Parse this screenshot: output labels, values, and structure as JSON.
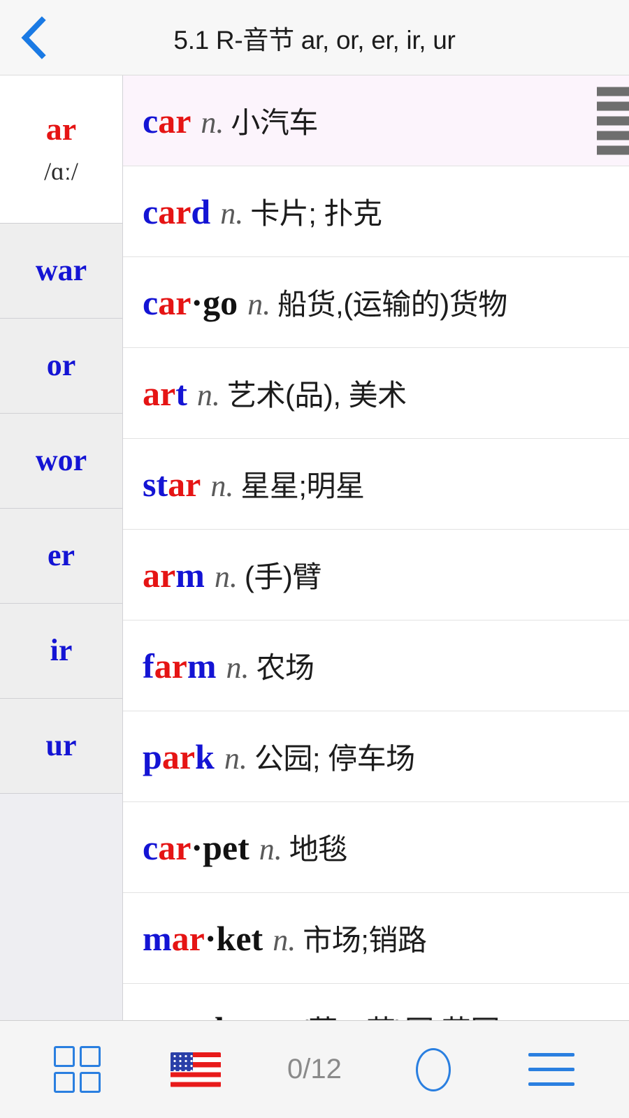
{
  "header": {
    "back_icon": "chevron-left-icon",
    "title": "5.1 R-音节 ar, or, er, ir, ur"
  },
  "sidebar": {
    "items": [
      {
        "label": "ar",
        "phonetic": "/ɑː/",
        "selected": true
      },
      {
        "label": "war",
        "phonetic": "",
        "selected": false
      },
      {
        "label": "or",
        "phonetic": "",
        "selected": false
      },
      {
        "label": "wor",
        "phonetic": "",
        "selected": false
      },
      {
        "label": "er",
        "phonetic": "",
        "selected": false
      },
      {
        "label": "ir",
        "phonetic": "",
        "selected": false
      },
      {
        "label": "ur",
        "phonetic": "",
        "selected": false
      }
    ]
  },
  "wordlist": {
    "rows": [
      {
        "parts": [
          {
            "t": "c",
            "c": "b"
          },
          {
            "t": "ar",
            "c": "r"
          }
        ],
        "pos": "n.",
        "def": "小汽车",
        "highlight": true,
        "grip": true
      },
      {
        "parts": [
          {
            "t": "c",
            "c": "b"
          },
          {
            "t": "ar",
            "c": "r"
          },
          {
            "t": "d",
            "c": "b"
          }
        ],
        "pos": "n.",
        "def": "卡片; 扑克",
        "highlight": false,
        "grip": false
      },
      {
        "parts": [
          {
            "t": "c",
            "c": "b"
          },
          {
            "t": "ar",
            "c": "r"
          },
          {
            "t": "·go",
            "c": "k"
          }
        ],
        "pos": "n.",
        "def": "船货,(运输的)货物",
        "highlight": false,
        "grip": false
      },
      {
        "parts": [
          {
            "t": "ar",
            "c": "r"
          },
          {
            "t": "t",
            "c": "b"
          }
        ],
        "pos": "n.",
        "def": "艺术(品), 美术",
        "highlight": false,
        "grip": false
      },
      {
        "parts": [
          {
            "t": "st",
            "c": "b"
          },
          {
            "t": "ar",
            "c": "r"
          }
        ],
        "pos": "n.",
        "def": "星星;明星",
        "highlight": false,
        "grip": false
      },
      {
        "parts": [
          {
            "t": "ar",
            "c": "r"
          },
          {
            "t": "m",
            "c": "b"
          }
        ],
        "pos": "n.",
        "def": "(手)臂",
        "highlight": false,
        "grip": false
      },
      {
        "parts": [
          {
            "t": "f",
            "c": "b"
          },
          {
            "t": "ar",
            "c": "r"
          },
          {
            "t": "m",
            "c": "b"
          }
        ],
        "pos": "n.",
        "def": "农场",
        "highlight": false,
        "grip": false
      },
      {
        "parts": [
          {
            "t": "p",
            "c": "b"
          },
          {
            "t": "ar",
            "c": "r"
          },
          {
            "t": "k",
            "c": "b"
          }
        ],
        "pos": "n.",
        "def": "公园; 停车场",
        "highlight": false,
        "grip": false
      },
      {
        "parts": [
          {
            "t": "c",
            "c": "b"
          },
          {
            "t": "ar",
            "c": "r"
          },
          {
            "t": "·pet",
            "c": "k"
          }
        ],
        "pos": "n.",
        "def": "地毯",
        "highlight": false,
        "grip": false
      },
      {
        "parts": [
          {
            "t": "m",
            "c": "b"
          },
          {
            "t": "ar",
            "c": "r"
          },
          {
            "t": "·ket",
            "c": "k"
          }
        ],
        "pos": "n.",
        "def": "市场;销路",
        "highlight": false,
        "grip": false
      },
      {
        "parts": [
          {
            "t": "g",
            "c": "b"
          },
          {
            "t": "ar",
            "c": "r"
          },
          {
            "t": "·den",
            "c": "k"
          }
        ],
        "pos": "n.",
        "def": "(菜、花)园,花园",
        "highlight": false,
        "grip": false
      }
    ]
  },
  "bottombar": {
    "grid_icon": "grid-icon",
    "flag_icon": "us-flag-icon",
    "counter": "0/12",
    "circle_icon": "circle-icon",
    "menu_icon": "hamburger-menu-icon"
  },
  "colors": {
    "accent_blue": "#2a7fe0",
    "word_blue": "#1414d4",
    "word_red": "#e51414",
    "highlight_row": "#fcf4fc",
    "sidebar_bg": "#eeeeee"
  }
}
